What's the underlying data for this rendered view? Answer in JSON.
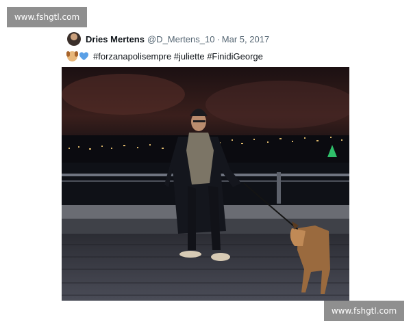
{
  "watermark": {
    "text": "www.fshgtl.com"
  },
  "tweet": {
    "author_name": "Dries Mertens",
    "handle": "@D_Mertens_10",
    "separator": "·",
    "date": "Mar 5, 2017",
    "emoji_icons": [
      "dog-face-emoji",
      "blue-heart-emoji"
    ],
    "text": "#forzanapolisempre #juliette #FinidiGeorge"
  },
  "colors": {
    "accent_heart": "#5aa0e6",
    "watermark_bg": "#8f8f8f"
  }
}
